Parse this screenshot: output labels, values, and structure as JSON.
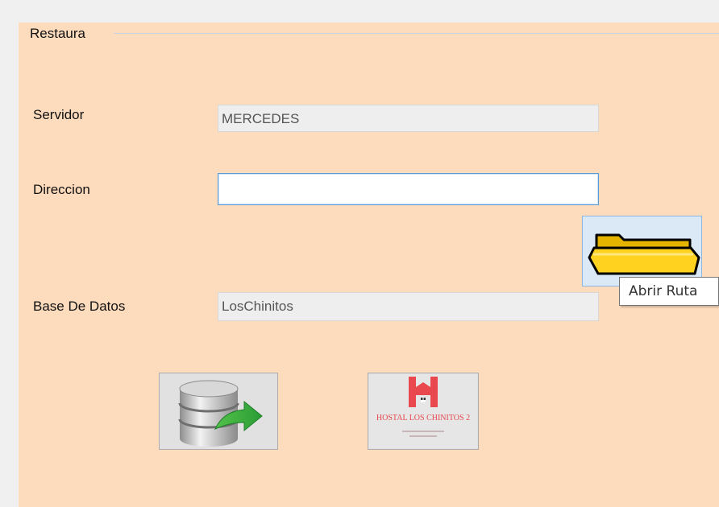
{
  "group": {
    "title": "Restaura"
  },
  "servidor": {
    "label": "Servidor",
    "value": "MERCEDES"
  },
  "direccion": {
    "label": "Direccion",
    "value": ""
  },
  "base_datos": {
    "label": "Base De Datos",
    "value": "LosChinitos"
  },
  "folder_button": {
    "icon": "folder-icon",
    "tooltip": "Abrir Ruta"
  },
  "restore_button": {
    "icon": "database-restore-icon"
  },
  "logo_button": {
    "icon": "hostal-logo-icon",
    "logo_text": "HOSTAL LOS CHINITOS 2"
  },
  "colors": {
    "panel_background": "#fddbbd",
    "form_background": "#f0f0f0",
    "folder_yellow": "#ffd21f",
    "logo_red": "#e8484e"
  }
}
